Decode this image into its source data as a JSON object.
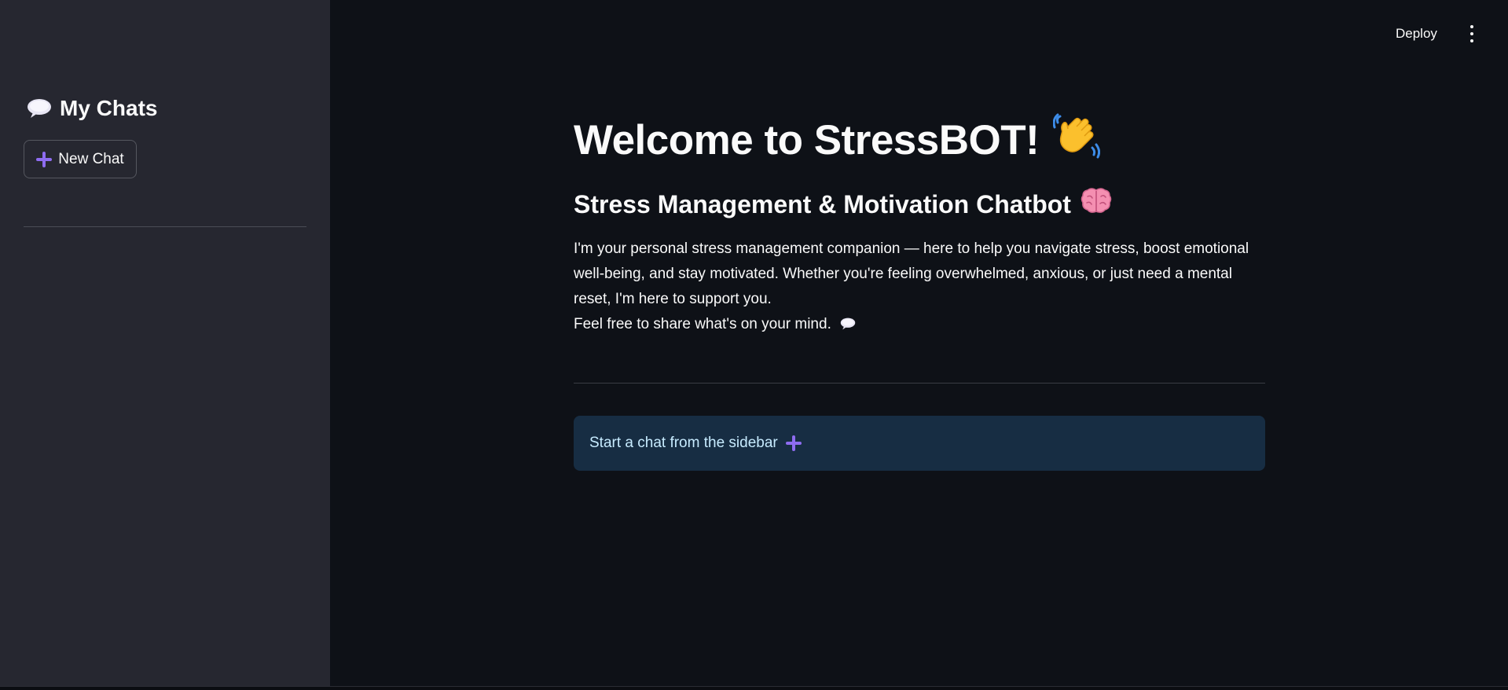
{
  "sidebar": {
    "title": "My Chats",
    "title_icon": "speech-bubble-icon",
    "new_chat_label": "New Chat",
    "new_chat_icon": "plus-icon"
  },
  "header": {
    "deploy_label": "Deploy",
    "menu_icon": "vertical-ellipsis-icon"
  },
  "main": {
    "title": "Welcome to StressBOT!",
    "title_icon": "waving-hand-icon",
    "subtitle": "Stress Management & Motivation Chatbot",
    "subtitle_icon": "brain-icon",
    "description_lines": [
      "I'm your personal stress management companion — here to help you navigate stress, boost emotional",
      "well-being, and stay motivated. Whether you're feeling overwhelmed, anxious, or just need a mental",
      "reset, I'm here to support you.",
      "Feel free to share what's on your mind."
    ],
    "description_end_icon": "speech-bubble-icon",
    "info_text": "Start a chat from the sidebar",
    "info_icon": "plus-icon"
  },
  "colors": {
    "background": "#0e1117",
    "sidebar": "#262730",
    "accent_plus": "#8e6cf0",
    "info_box": "#172d43",
    "info_text": "#c7ebff"
  }
}
